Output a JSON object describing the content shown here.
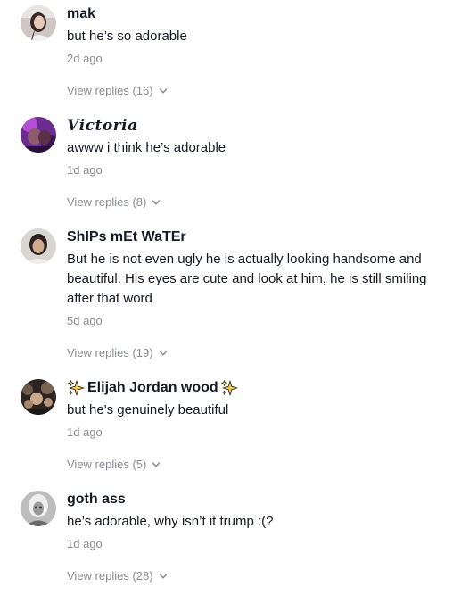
{
  "comments": [
    {
      "username": "mak",
      "text": "but he’s so adorable",
      "time": "2d ago",
      "replies_label": "View replies (16)"
    },
    {
      "username": "𝑽𝒊𝒄𝒕𝒐𝒓𝒊𝒂",
      "text": "awww i think he’s adorable",
      "time": "1d ago",
      "replies_label": "View replies (8)"
    },
    {
      "username": "ShIPs mEt WaTEr",
      "text": "But he is not even ugly he is actually looking handsome and beautiful. His eyes are cute and look at him, he is still smiling after that word",
      "time": "5d ago",
      "replies_label": "View replies (19)"
    },
    {
      "username": "Elijah Jordan wood",
      "text": "but he's genuinely beautiful",
      "time": "1d ago",
      "replies_label": "View replies (5)"
    },
    {
      "username": "goth ass",
      "text": "he’s adorable, why isn’t it trump :(?",
      "time": "1d ago",
      "replies_label": "View replies (28)"
    }
  ],
  "icons": {
    "expand": "chevron-down-icon",
    "sparkles": "sparkles-icon"
  },
  "colors": {
    "primary_text": "#161823",
    "secondary_text": "#8a8b91",
    "sparkle": "#f7c948"
  }
}
